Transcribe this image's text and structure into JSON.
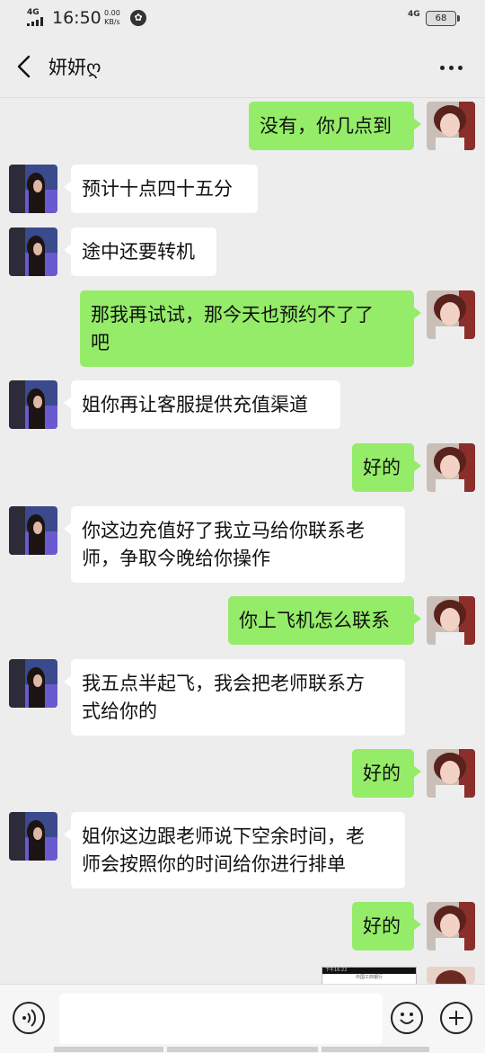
{
  "status_bar": {
    "network_left": "4G",
    "time": "16:50",
    "speed_value": "0.00",
    "speed_unit": "KB/s",
    "network_right": "4G",
    "battery": "68"
  },
  "header": {
    "title": "妍妍ღ",
    "back_icon": "chevron-left-icon",
    "more_icon": "more-dots-icon"
  },
  "messages": [
    {
      "side": "out",
      "lines": [
        "没有，你几点到"
      ]
    },
    {
      "side": "in",
      "lines": [
        "预计十点四十五分"
      ]
    },
    {
      "side": "in",
      "lines": [
        "途中还要转机"
      ]
    },
    {
      "side": "out",
      "lines": [
        "那我再试试，那今天也预约不了了",
        "吧"
      ]
    },
    {
      "side": "in",
      "lines": [
        "姐你再让客服提供充值渠道"
      ]
    },
    {
      "side": "out",
      "lines": [
        "好的"
      ]
    },
    {
      "side": "in",
      "lines": [
        "你这边充值好了我立马给你联系老",
        "师，争取今晚给你操作"
      ]
    },
    {
      "side": "out",
      "lines": [
        "你上飞机怎么联系"
      ]
    },
    {
      "side": "in",
      "lines": [
        "我五点半起飞，我会把老师联系方",
        "式给你的"
      ]
    },
    {
      "side": "out",
      "lines": [
        "好的"
      ]
    },
    {
      "side": "in",
      "lines": [
        "姐你这边跟老师说下空余时间，老",
        "师会按照你的时间给你进行排单"
      ]
    },
    {
      "side": "out",
      "lines": [
        "好的"
      ]
    }
  ],
  "image_message": {
    "thumb_status": "下午16:22",
    "thumb_title": "中国工商银行"
  },
  "input_bar": {
    "voice_icon": "voice-icon",
    "emoji_icon": "emoji-icon",
    "plus_icon": "plus-icon",
    "placeholder": ""
  },
  "colors": {
    "background": "#ededed",
    "outgoing_bubble": "#95ec69",
    "incoming_bubble": "#ffffff"
  }
}
